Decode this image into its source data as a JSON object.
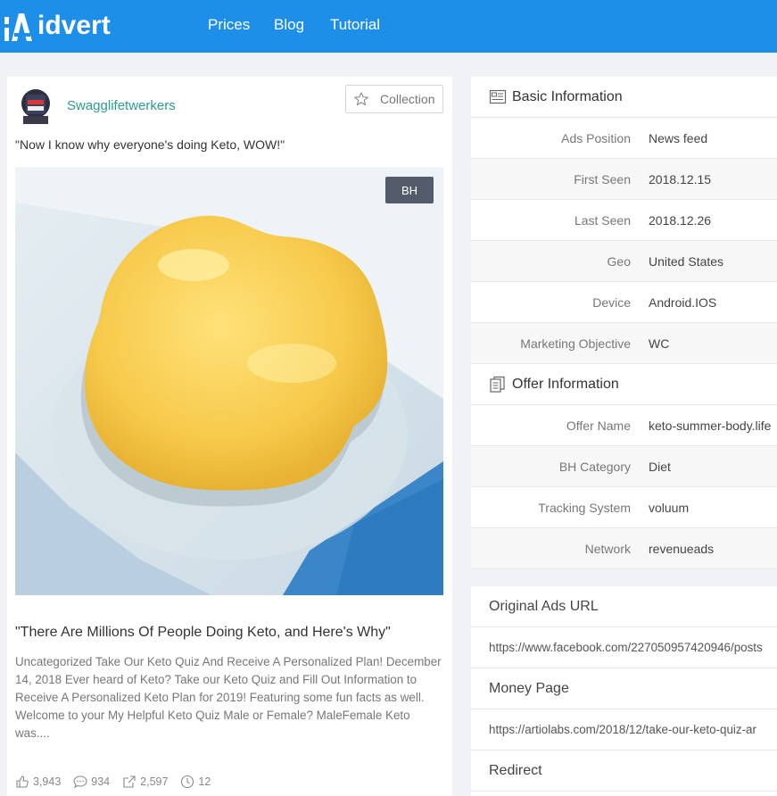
{
  "header": {
    "logo_text": "idvert",
    "nav": [
      {
        "label": "Prices"
      },
      {
        "label": "Blog"
      },
      {
        "label": "Tutorial"
      }
    ]
  },
  "ad": {
    "page_name": "Swagglifetwerkers",
    "collection_label": "Collection",
    "ad_text": "\"Now I know why everyone's doing Keto, WOW!\"",
    "badge": "BH",
    "headline": "\"There Are Millions Of People Doing Keto, and Here's Why\"",
    "description": "Uncategorized Take Our Keto Quiz And Receive A Personalized Plan! December 14, 2018 Ever heard of Keto? Take our Keto Quiz and Fill Out Information to Receive A Personalized Keto Plan for 2019! Featuring some fun facts as well. Welcome to your My Helpful Keto Quiz Male or Female? MaleFemale Keto was....",
    "stats": {
      "likes": "3,943",
      "comments": "934",
      "shares": "2,597",
      "days": "12"
    }
  },
  "basic_info": {
    "title": "Basic Information",
    "rows": [
      {
        "key": "Ads Position",
        "value": "News feed"
      },
      {
        "key": "First Seen",
        "value": "2018.12.15"
      },
      {
        "key": "Last Seen",
        "value": "2018.12.26"
      },
      {
        "key": "Geo",
        "value": "United States"
      },
      {
        "key": "Device",
        "value": "Android.IOS"
      },
      {
        "key": "Marketing Objective",
        "value": "WC"
      }
    ]
  },
  "offer_info": {
    "title": "Offer Information",
    "rows": [
      {
        "key": "Offer Name",
        "value": "keto-summer-body.life"
      },
      {
        "key": "BH Category",
        "value": "Diet"
      },
      {
        "key": "Tracking System",
        "value": "voluum"
      },
      {
        "key": "Network",
        "value": "revenueads"
      }
    ]
  },
  "urls": {
    "original_title": "Original Ads URL",
    "original_value": "https://www.facebook.com/227050957420946/posts",
    "money_title": "Money Page",
    "money_value": "https://artiolabs.com/2018/12/take-our-keto-quiz-ar",
    "redirect_title": "Redirect"
  },
  "colors": {
    "header_bg": "#1e8fe9",
    "page_name": "#2a9b8f",
    "badge_bg": "#545b6b"
  }
}
